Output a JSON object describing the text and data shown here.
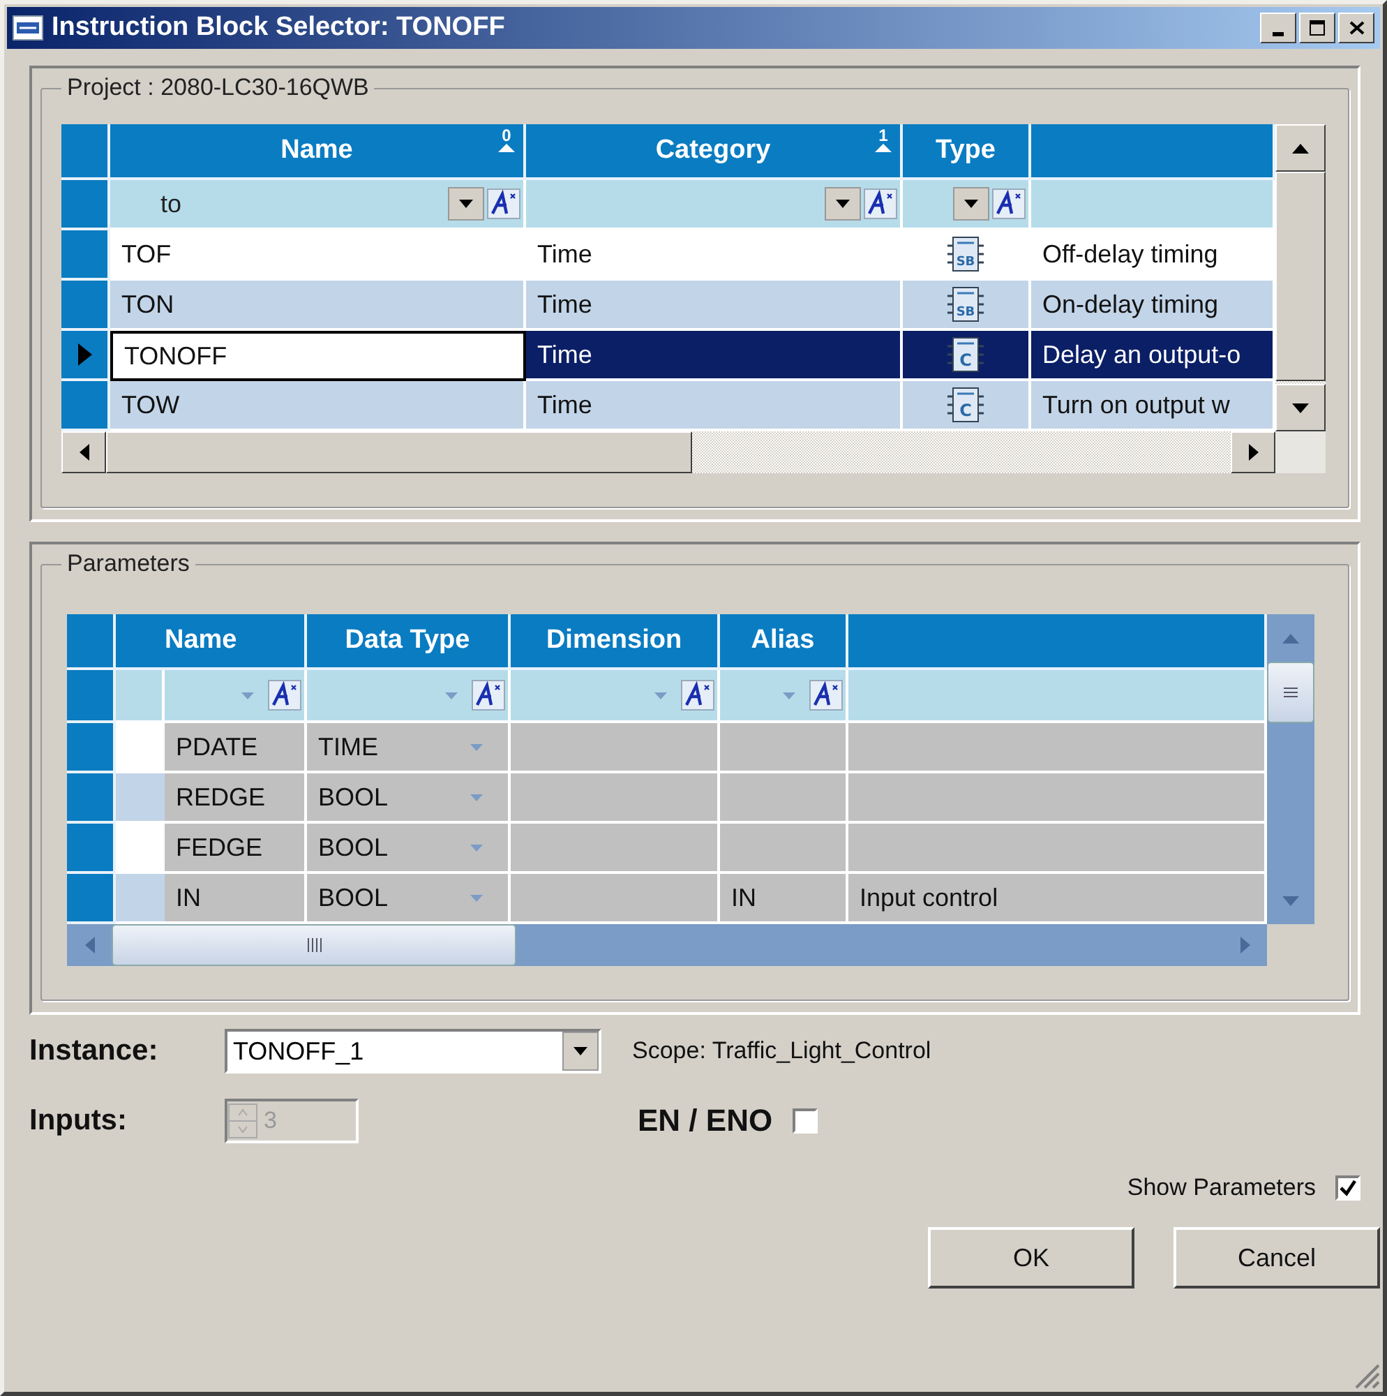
{
  "window": {
    "title": "Instruction Block Selector: TONOFF"
  },
  "project": {
    "label": "Project : 2080-LC30-16QWB",
    "columns": [
      {
        "label": "Name",
        "sort": "0"
      },
      {
        "label": "Category",
        "sort": "1"
      },
      {
        "label": "Type"
      }
    ],
    "filter": "to",
    "rows": [
      {
        "name": "TOF",
        "category": "Time",
        "icon_label": "SB",
        "description": "Off-delay timing",
        "selected": false
      },
      {
        "name": "TON",
        "category": "Time",
        "icon_label": "SB",
        "description": "On-delay timing",
        "selected": false
      },
      {
        "name": "TONOFF",
        "category": "Time",
        "icon_label": "C",
        "description": "Delay an output-o",
        "selected": true
      },
      {
        "name": "TOW",
        "category": "Time",
        "icon_label": "C",
        "description": "Turn on  output w",
        "selected": false
      }
    ]
  },
  "parameters": {
    "label": "Parameters",
    "columns": [
      "Name",
      "Data Type",
      "Dimension",
      "Alias"
    ],
    "rows": [
      {
        "name": "PDATE",
        "data_type": "TIME"
      },
      {
        "name": "REDGE",
        "data_type": "BOOL"
      },
      {
        "name": "FEDGE",
        "data_type": "BOOL"
      },
      {
        "name": "IN",
        "data_type": "BOOL",
        "alias": "IN",
        "description": "Input control"
      }
    ]
  },
  "instance": {
    "label": "Instance:",
    "value": "TONOFF_1",
    "scope": "Scope: Traffic_Light_Control"
  },
  "inputs": {
    "label": "Inputs:",
    "value": "3",
    "disabled": true
  },
  "en_eno": {
    "label": "EN / ENO",
    "checked": false
  },
  "show_parameters": {
    "label": "Show Parameters",
    "checked": true
  },
  "buttons": [
    "OK",
    "Cancel"
  ]
}
